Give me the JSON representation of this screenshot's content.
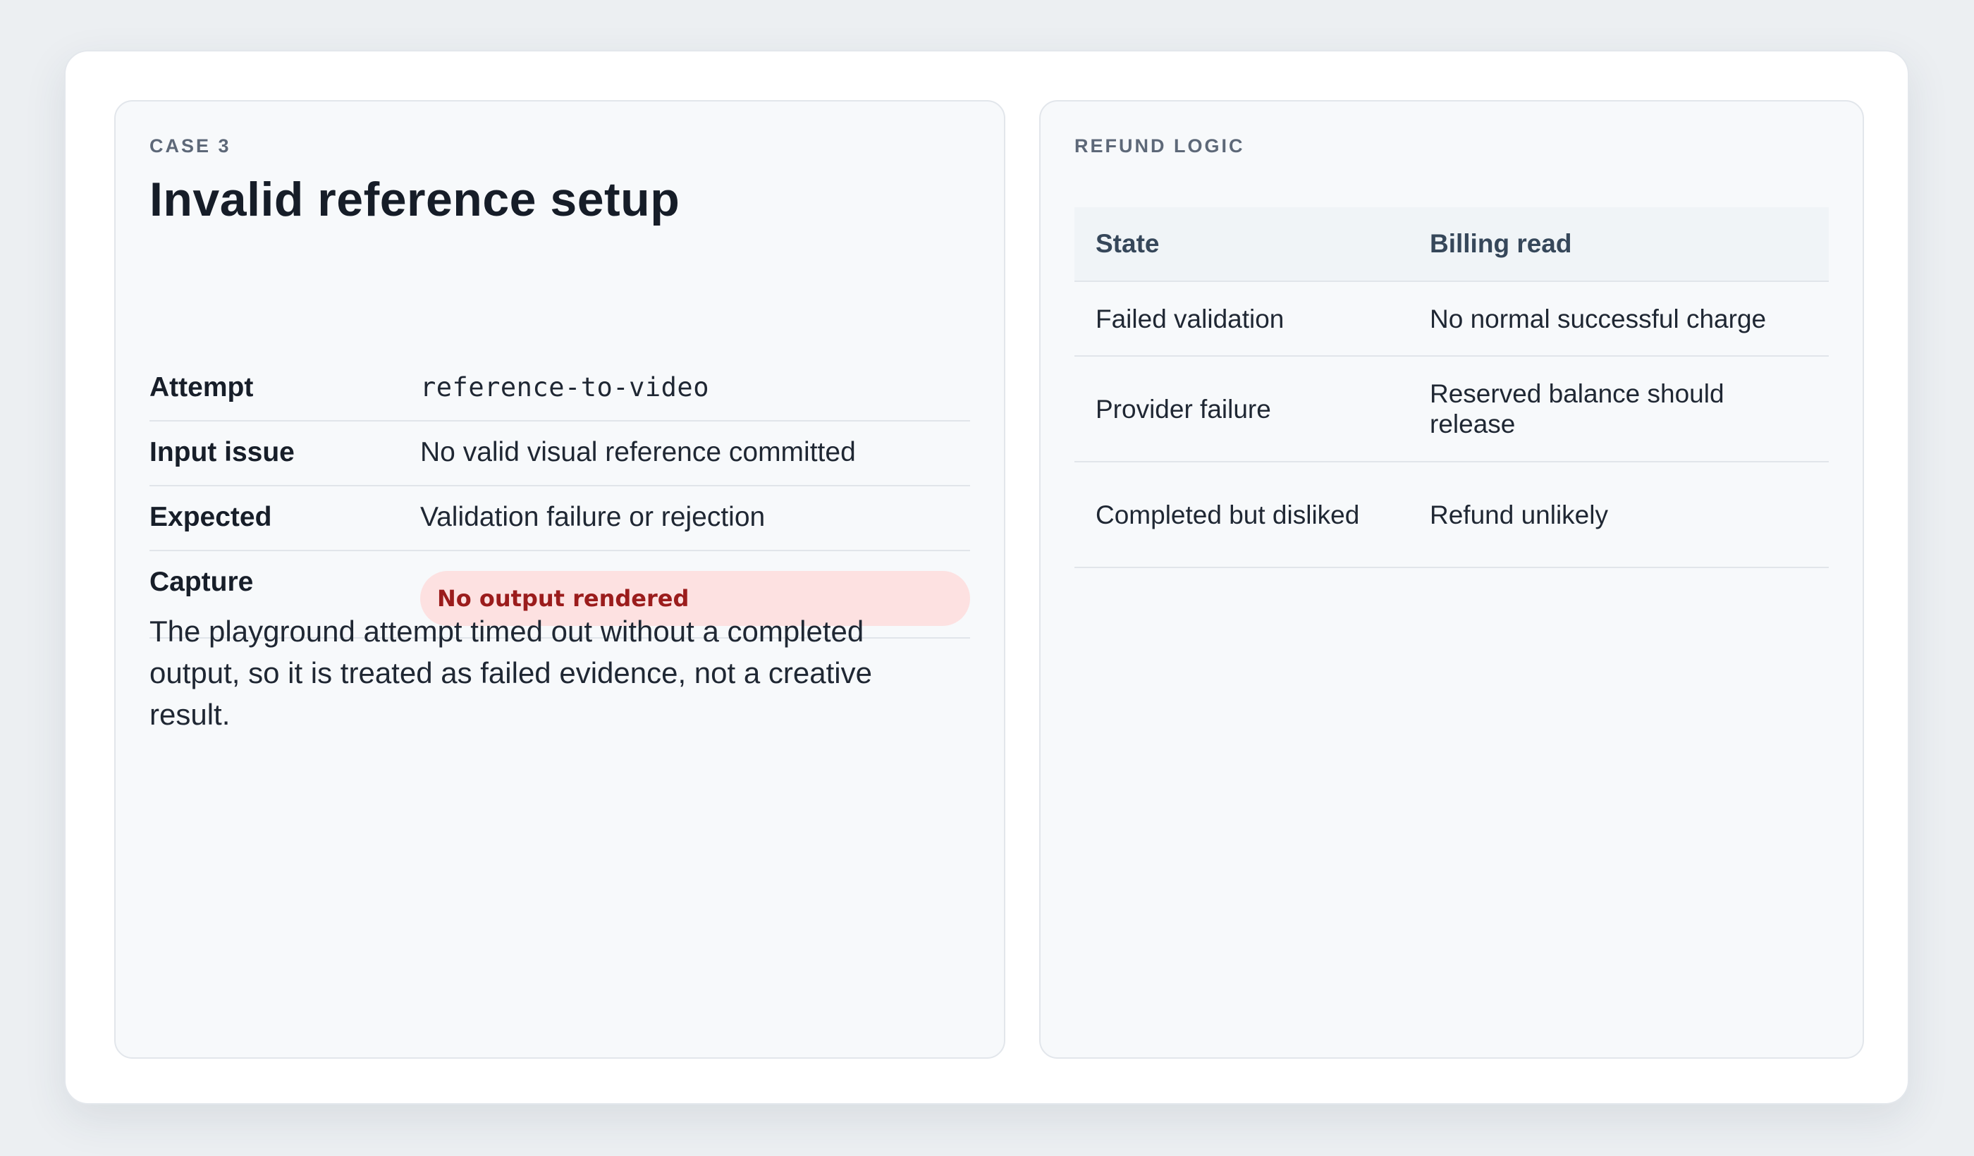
{
  "case": {
    "eyebrow": "CASE 3",
    "title": "Invalid reference setup",
    "details": [
      {
        "label": "Attempt",
        "value": "reference-to-video"
      },
      {
        "label": "Input issue",
        "value": "No valid visual reference committed"
      },
      {
        "label": "Expected",
        "value": "Validation failure or rejection"
      },
      {
        "label": "Capture",
        "value": "No output rendered"
      }
    ],
    "note": "The playground attempt timed out without a completed output, so it is treated as failed evidence, not a creative result.",
    "status_color": "#9b1c1c"
  },
  "refund": {
    "eyebrow": "REFUND LOGIC",
    "columns": [
      "State",
      "Billing read"
    ],
    "rows": [
      [
        "Failed validation",
        "No normal successful charge"
      ],
      [
        "Provider failure",
        "Reserved balance should release"
      ],
      [
        "Completed but disliked",
        "Refund unlikely"
      ]
    ]
  }
}
